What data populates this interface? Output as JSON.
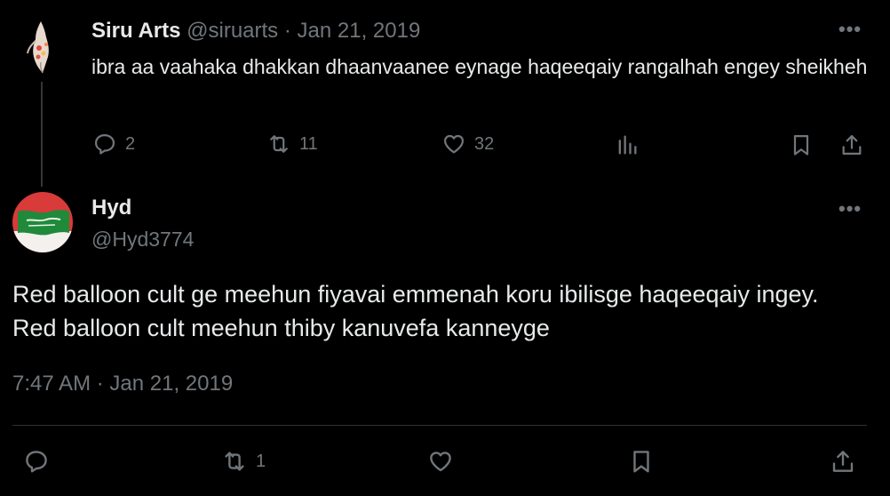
{
  "parent_tweet": {
    "display_name": "Siru Arts",
    "handle": "@siruarts",
    "separator": "·",
    "date": "Jan 21, 2019",
    "text": "ibra aa vaahaka dhakkan dhaanvaanee eynage haqeeqaiy rangalhah engey sheikheh",
    "more_icon": "more-horizontal-icon",
    "actions": {
      "replies": "2",
      "reposts": "11",
      "likes": "32"
    }
  },
  "main_tweet": {
    "display_name": "Hyd",
    "handle": "@Hyd3774",
    "text": "Red balloon cult ge meehun fiyavai emmenah koru ibilisge haqeeqaiy ingey. Red balloon cult meehun thiby kanuvefa kanneyge",
    "timestamp": "7:47 AM · Jan 21, 2019",
    "more_icon": "more-horizontal-icon",
    "actions": {
      "reposts": "1"
    }
  },
  "colors": {
    "background": "#000000",
    "primary_text": "#e7e9ea",
    "secondary_text": "#71767b",
    "divider": "#2f3336"
  }
}
